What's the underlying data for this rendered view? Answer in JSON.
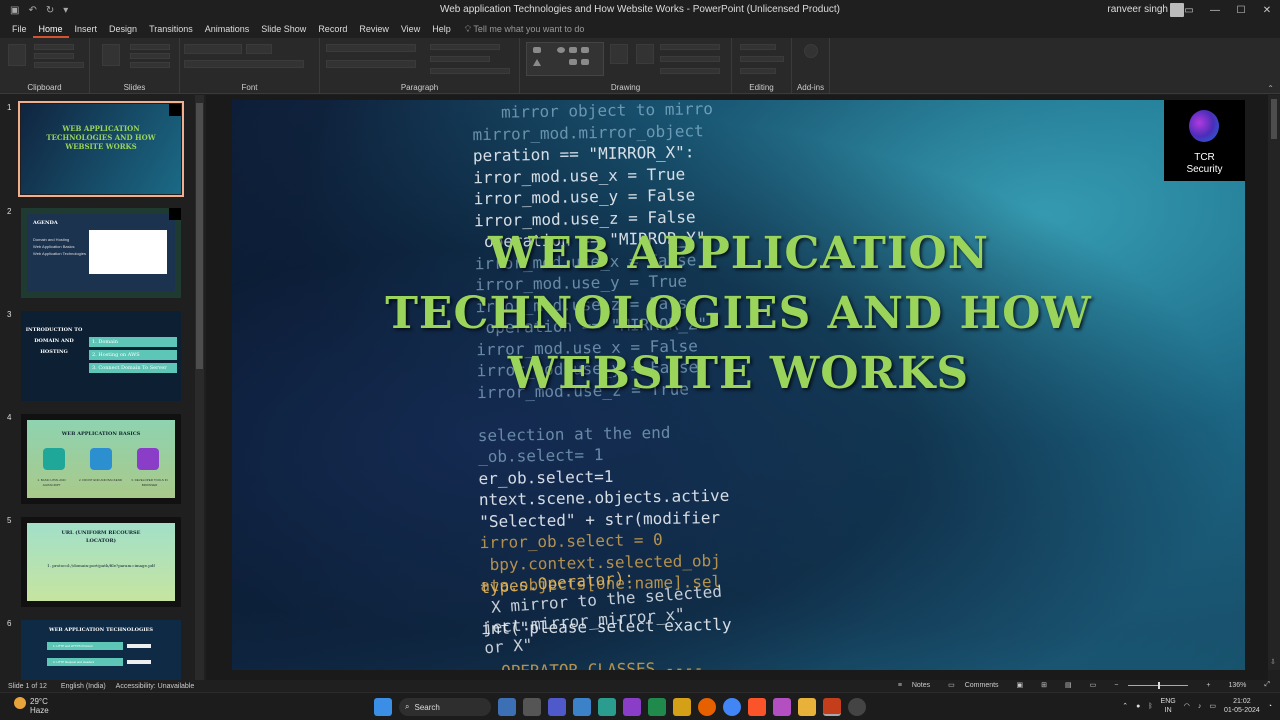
{
  "window": {
    "title": "Web application Technologies and How Website Works  -  PowerPoint (Unlicensed Product)",
    "user": "ranveer singh"
  },
  "menu": {
    "tabs": [
      "File",
      "Home",
      "Insert",
      "Design",
      "Transitions",
      "Animations",
      "Slide Show",
      "Record",
      "Review",
      "View",
      "Help"
    ],
    "active": "Home",
    "tell_me": "Tell me what you want to do"
  },
  "ribbon": {
    "groups": [
      "Clipboard",
      "Slides",
      "Font",
      "Paragraph",
      "Drawing",
      "Editing",
      "Add-ins"
    ]
  },
  "thumbnails": [
    {
      "num": "1",
      "title": "WEB APPLICATION TECHNOLOGIES AND HOW WEBSITE WORKS"
    },
    {
      "num": "2",
      "title": "AGENDA",
      "items": [
        "Domain and Hosting",
        "Web Application Basics",
        "Web Application Technologies"
      ]
    },
    {
      "num": "3",
      "title": "INTRODUCTION TO DOMAIN AND HOSTING",
      "items": [
        "1. Domain",
        "2. Hosting on AWS",
        "3. Connect Domain To Server"
      ]
    },
    {
      "num": "4",
      "title": "WEB APPLICATION BASICS",
      "items": [
        "1. BASIC HTML AND JAVASCRIPT",
        "2. FRONT END AND BACKEND",
        "3. DEVELOPER TOOLS IN BROWSER"
      ]
    },
    {
      "num": "5",
      "title": "URL (UNIFORM RECOURSE LOCATOR)",
      "text": "1. protocol://domain:port/path/file?param=image.pdf"
    },
    {
      "num": "6",
      "title": "WEB APPLICATION TECHNOLOGIES",
      "items": [
        "1. HTTP and HTTPS Protocol",
        "2. HTTP Request and Headers"
      ]
    }
  ],
  "slide": {
    "title_lines": [
      "WEB APPLICATION",
      "TECHNOLOGIES AND HOW",
      "WEBSITE WORKS"
    ],
    "logo_text": [
      "TCR",
      "Security"
    ],
    "code_lines": [
      "   mirror object to mirro",
      "mirror_mod.mirror_object",
      "peration == \"MIRROR_X\":",
      "irror_mod.use_x = True",
      "irror_mod.use_y = False",
      "irror_mod.use_z = False",
      " operation == \"MIRROR_Y\"",
      "irror_mod.use_x = False",
      "irror_mod.use_y = True",
      "irror_mod.use_z = False",
      " operation == \"MIRROR_Z\"",
      "irror_mod.use_x = False",
      "irror_mod.use_y = False",
      "irror_mod.use_z = True",
      "",
      "selection at the end",
      "_ob.select= 1",
      "er_ob.select=1",
      "ntext.scene.objects.active",
      "\"Selected\" + str(modifier",
      "irror_ob.select = 0",
      " bpy.context.selected_obj",
      "ata.objects[one.name].sel",
      "",
      "int(\"please select exactly",
      "",
      "  OPERATOR CLASSES ----"
    ],
    "code_lines_bottom": [
      "types.Operator):",
      " X mirror to the selected",
      "ject.mirror_mirror_x\"",
      "or X\""
    ]
  },
  "status": {
    "slide_of": "Slide 1 of 12",
    "language": "English (India)",
    "accessibility": "Accessibility: Unavailable",
    "notes": "Notes",
    "comments": "Comments",
    "zoom": "136%"
  },
  "taskbar": {
    "temp": "29°C",
    "weather": "Haze",
    "search": "Search",
    "lang_line1": "ENG",
    "lang_line2": "IN",
    "time": "21:02",
    "date": "01-05-2024"
  }
}
